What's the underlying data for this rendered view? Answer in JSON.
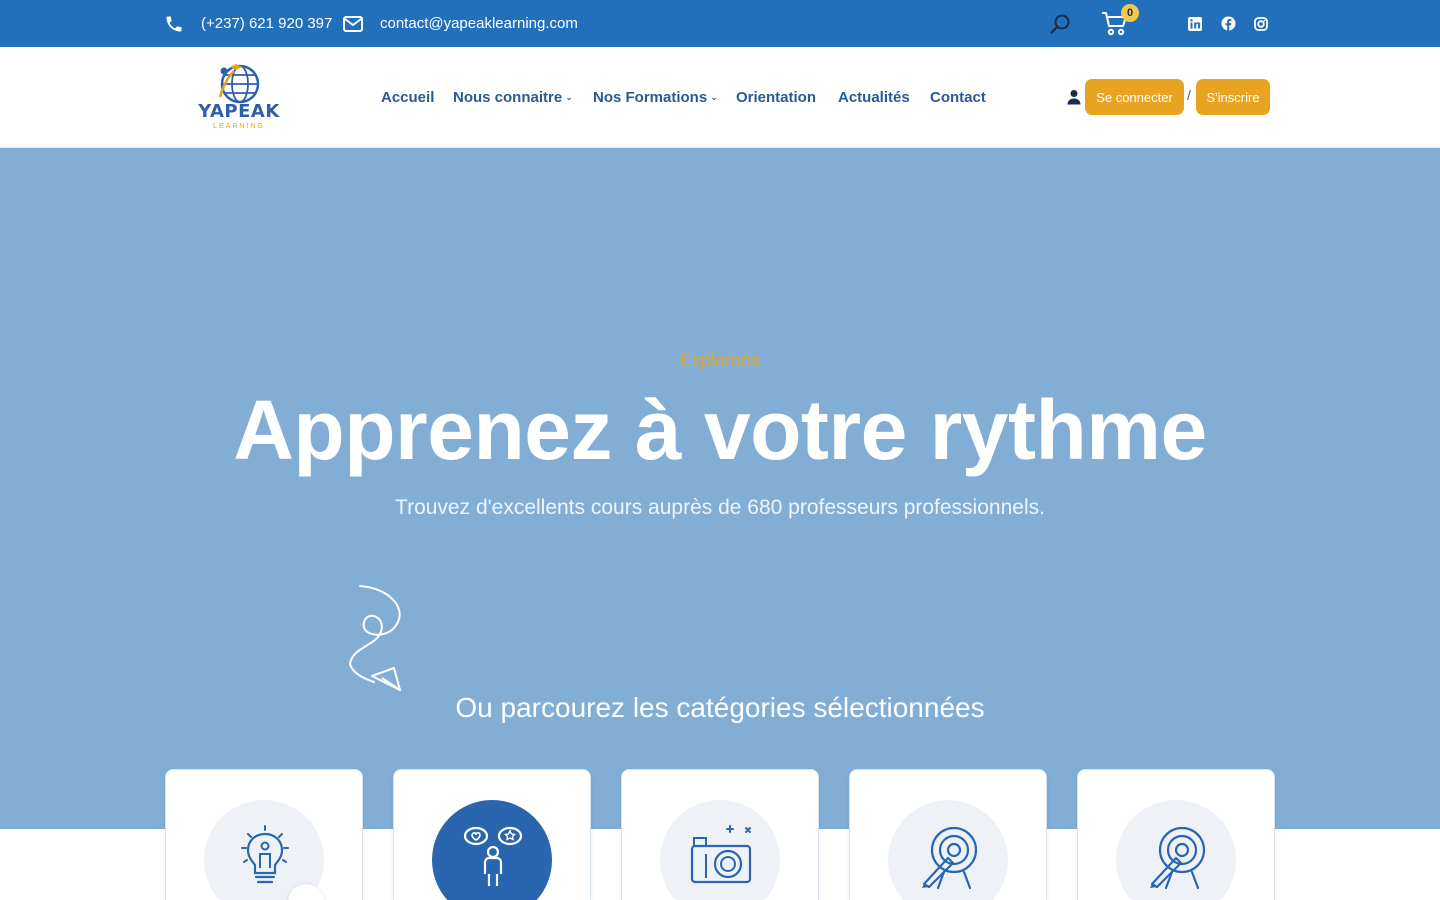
{
  "topbar": {
    "phone": "(+237) 621 920 397",
    "email": "contact@yapeaklearning.com",
    "cart_count": "0",
    "icons": [
      "phone-icon",
      "mail-icon",
      "search-icon",
      "cart-icon",
      "linkedin-icon",
      "facebook-icon",
      "instagram-icon"
    ]
  },
  "header": {
    "logo_text": "YAPEAK",
    "logo_sub": "LEARNING",
    "nav": [
      "Accueil",
      "Nous connaitre",
      "Nos Formations",
      "Orientation",
      "Actualités",
      "Contact"
    ],
    "login_label": "Se connecter",
    "separator": "/",
    "signup_label": "S'inscrire"
  },
  "hero": {
    "eyebrow": "Explorons",
    "title": "Apprenez à votre rythme",
    "subtitle": "Trouvez d'excellents cours auprès de 680 professeurs professionnels.",
    "categories_heading": "Ou parcourez les catégories sélectionnées"
  },
  "categories": [
    {
      "icon": "lightbulb-person-icon"
    },
    {
      "icon": "person-thoughts-icon"
    },
    {
      "icon": "camera-icon"
    },
    {
      "icon": "target-pencil-icon"
    },
    {
      "icon": "target-pencil-icon"
    }
  ],
  "colors": {
    "topbar": "#2270bb",
    "hero": "#82aed6",
    "accent": "#e8a421",
    "nav_text": "#2b5a92"
  }
}
